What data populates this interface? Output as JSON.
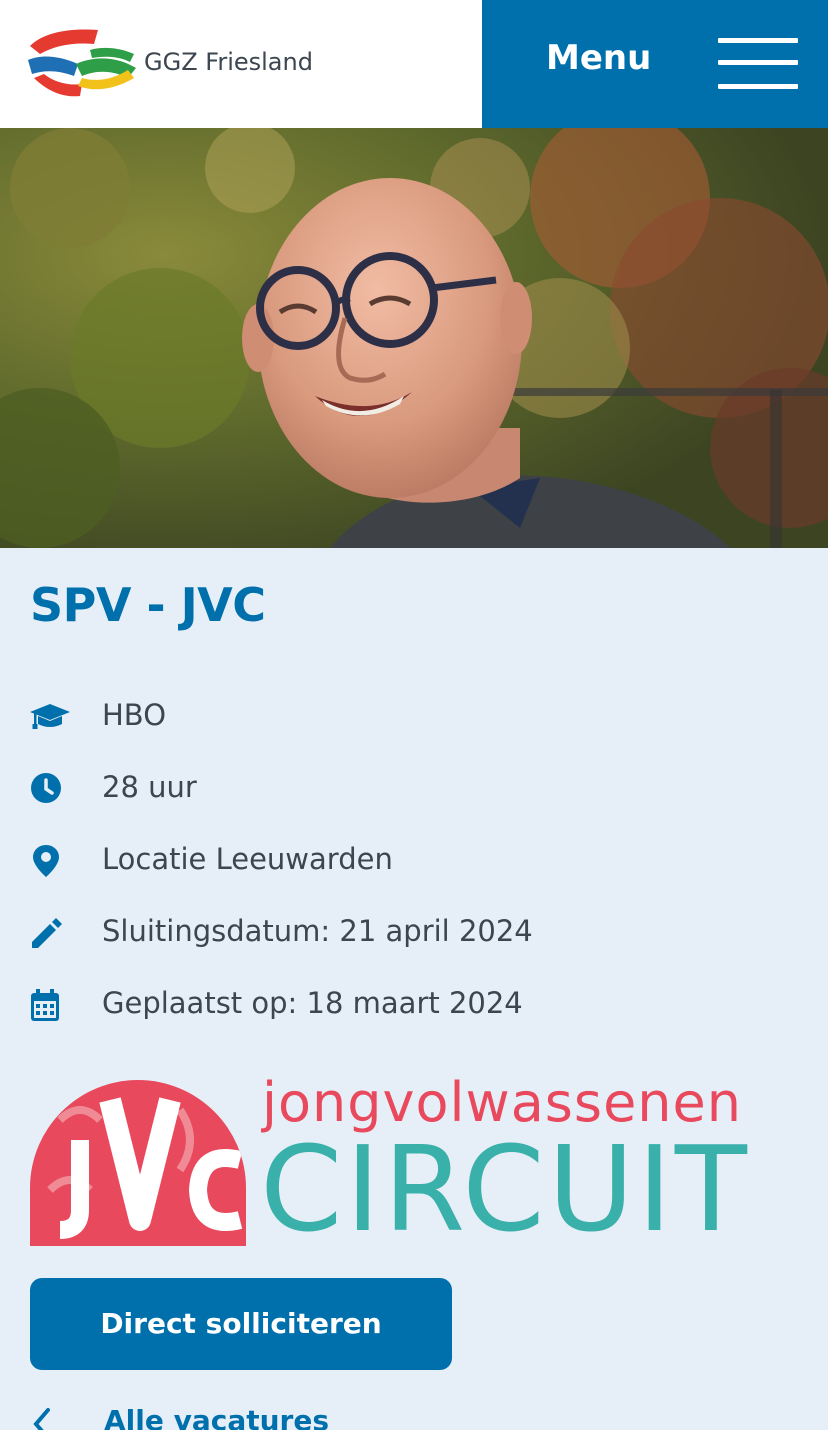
{
  "header": {
    "brand_name": "GGZ Friesland",
    "menu_label": "Menu",
    "menu_color": "#0070ad"
  },
  "hero": {
    "alt": "Smiling man with glasses in front of autumn foliage"
  },
  "vacancy": {
    "title": "SPV - JVC",
    "meta": [
      {
        "icon": "graduation-cap-icon",
        "text": "HBO"
      },
      {
        "icon": "clock-icon",
        "text": "28 uur"
      },
      {
        "icon": "location-pin-icon",
        "text": "Locatie Leeuwarden"
      },
      {
        "icon": "pencil-icon",
        "text": "Sluitingsdatum: 21 april 2024"
      },
      {
        "icon": "calendar-icon",
        "text": "Geplaatst op: 18 maart 2024"
      }
    ]
  },
  "program_logo": {
    "line1": "jongvolwassenen",
    "line2": "CIRCUIT",
    "mark": "JVC",
    "pink": "#e8495d",
    "teal": "#3ab0aa"
  },
  "actions": {
    "apply_label": "Direct solliciteren",
    "back_label": "Alle vacatures"
  }
}
